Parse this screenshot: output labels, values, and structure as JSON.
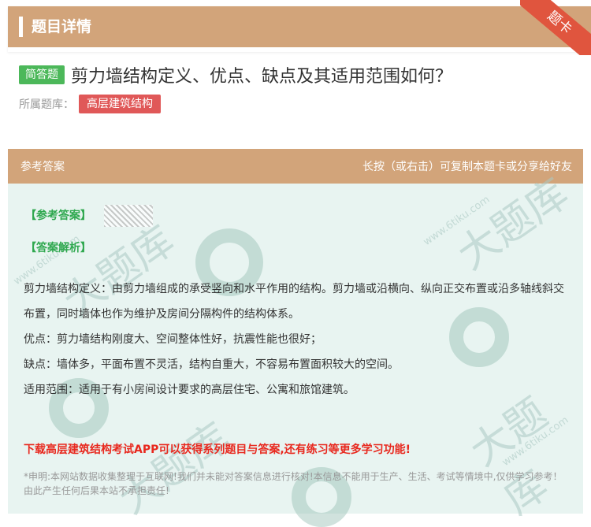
{
  "header": {
    "title": "题目详情",
    "ribbon_label": "题卡"
  },
  "question": {
    "type_tag": "简答题",
    "text": "剪力墙结构定义、优点、缺点及其适用范围如何？",
    "bank_label": "所属题库：",
    "bank_tag": "高层建筑结构"
  },
  "answer_section": {
    "header_left": "参考答案",
    "header_right": "长按（或右击）可复制本题卡或分享给好友",
    "ref_answer_label": "【参考答案】",
    "analysis_label": "【答案解析】",
    "paragraphs": [
      "剪力墙结构定义：由剪力墙组成的承受竖向和水平作用的结构。剪力墙或沿横向、纵向正交布置或沿多轴线斜交布置，同时墙体也作为维护及房间分隔构件的结构体系。",
      "优点：剪力墙结构刚度大、空间整体性好，抗震性能也很好；",
      "缺点：墙体多，平面布置不灵活，结构自重大，不容易布置面积较大的空间。",
      "适用范围：适用于有小房间设计要求的高层住宅、公寓和旅馆建筑。"
    ],
    "promo": "下载高层建筑结构考试APP可以获得系列题目与答案,还有练习等更多学习功能!",
    "disclaimer": "*申明:本网站数据收集整理于互联网!我们并未能对答案信息进行核对!本信息不能用于生产、生活、考试等情境中,仅供学习参考！由此产生任何后果本站不承担责任!"
  },
  "watermark": {
    "big_text": "大题库",
    "url_text": "www.6tiku.com"
  },
  "colors": {
    "header": "#d2a47a",
    "ribbon": "#e0553e",
    "type_tag": "#4cb85a",
    "bank_tag": "#e05858",
    "answer_bg": "#e8f4f1",
    "promo": "#e8281e"
  }
}
